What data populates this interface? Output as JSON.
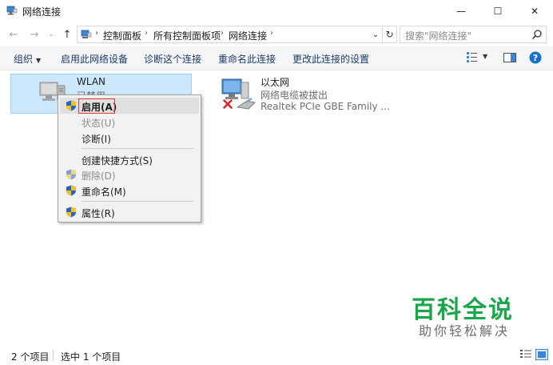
{
  "window": {
    "title": "网络连接",
    "minimize": "—",
    "maximize": "☐",
    "close": "✕"
  },
  "nav": {
    "back": "←",
    "forward": "→",
    "recent": "⌄",
    "up": "↑",
    "breadcrumb": [
      "控制面板",
      "所有控制面板项",
      "网络连接"
    ],
    "dropdown": "⌄",
    "refresh": "↻",
    "search_placeholder": "搜索\"网络连接\""
  },
  "commands": {
    "organize": "组织",
    "enable_device": "启用此网络设备",
    "diagnose": "诊断这个连接",
    "rename": "重命名此连接",
    "change_settings": "更改此连接的设置"
  },
  "items": {
    "wlan": {
      "name": "WLAN",
      "status": "已禁用"
    },
    "ethernet": {
      "name": "以太网",
      "status": "网络电缆被拔出",
      "device": "Realtek PCIe GBE Family ..."
    }
  },
  "context_menu": {
    "enable": "启用(A)",
    "status": "状态(U)",
    "diagnose": "诊断(I)",
    "shortcut": "创建快捷方式(S)",
    "delete": "删除(D)",
    "rename": "重命名(M)",
    "properties": "属性(R)"
  },
  "watermark": {
    "title": "百科全说",
    "subtitle": "助你轻松解决"
  },
  "status_bar": {
    "item_count": "2 个项目",
    "selected": "选中 1 个项目"
  },
  "colors": {
    "accent": "#0078d7",
    "selection": "#cce8ff",
    "highlight_box": "#e53935",
    "watermark_green": "#1aa64b"
  }
}
